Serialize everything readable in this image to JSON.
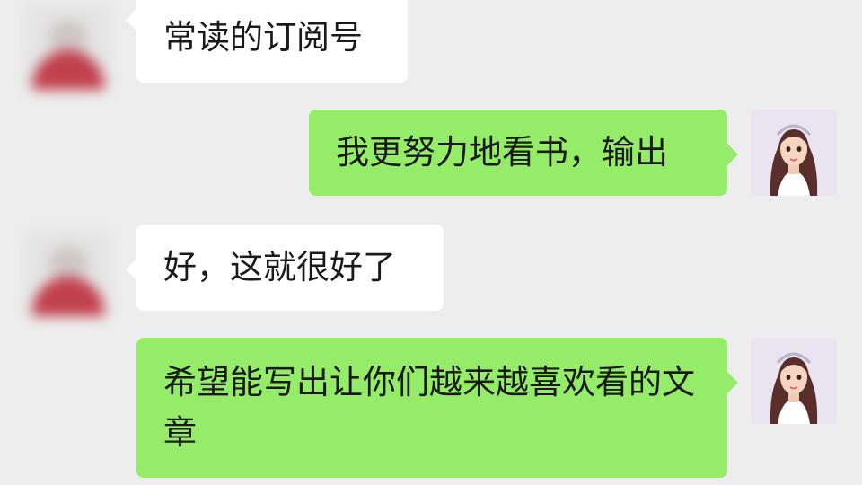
{
  "messages": [
    {
      "side": "left",
      "text": "常读的订阅号"
    },
    {
      "side": "right",
      "text": "我更努力地看书，输出"
    },
    {
      "side": "left",
      "text": "好，这就很好了"
    },
    {
      "side": "right",
      "text": "希望能写出让你们越来越喜欢看的文章"
    }
  ],
  "colors": {
    "background": "#ededed",
    "incoming_bubble": "#ffffff",
    "outgoing_bubble": "#95ec69"
  }
}
